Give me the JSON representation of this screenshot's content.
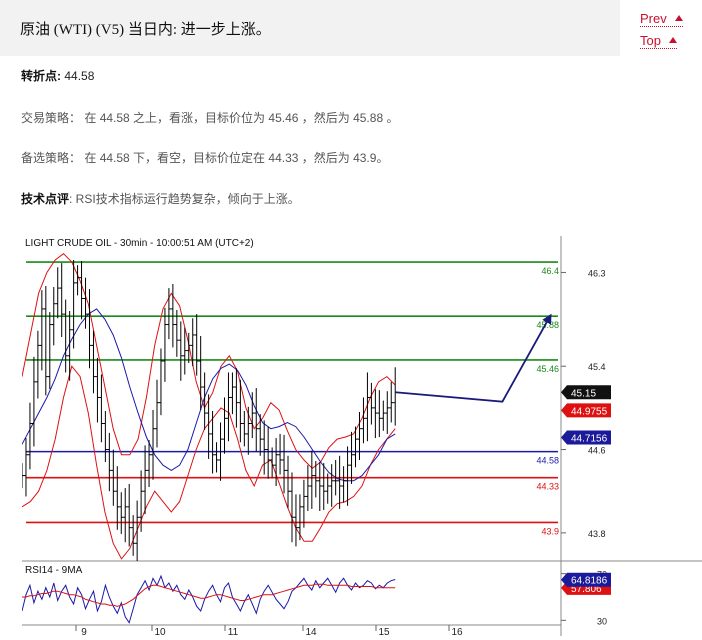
{
  "header": {
    "title": "原油 (WTI) (V5) 当日内: 进一步上涨。"
  },
  "nav": {
    "prev": "Prev",
    "top": "Top"
  },
  "pivot": {
    "label": "转折点:",
    "value": "44.58"
  },
  "strategy": {
    "label": "交易策略：",
    "text": "在 44.58 之上，看涨，目标价位为 45.46 ，然后为 45.88 。"
  },
  "alternative": {
    "label": "备选策略：",
    "text": "在 44.58 下，看空，目标价位定在 44.33 ，然后为 43.9。"
  },
  "comment": {
    "label": "技术点评",
    "text": ": RSI技术指标运行趋势复杂，倾向于上涨。"
  },
  "colors": {
    "resistance": "#1a8a1a",
    "pivot": "#1a1aaa",
    "support": "#dd1111",
    "bollinger": "#dd1111",
    "ma": "#1a1aaa",
    "arrow": "#1a1a7a"
  },
  "chart_data": [
    {
      "type": "candlestick",
      "title": "LIGHT CRUDE OIL - 30min - 10:00:51 AM (UTC+2)",
      "x_ticks": [
        "9",
        "10",
        "11",
        "14",
        "15",
        "16"
      ],
      "y_ticks": [
        46.3,
        45.4,
        44.6,
        43.8
      ],
      "ylim": [
        43.53,
        46.65
      ],
      "levels": [
        {
          "label": "46.4",
          "value": 46.4,
          "kind": "resistance"
        },
        {
          "label": "45.88",
          "value": 45.88,
          "kind": "resistance"
        },
        {
          "label": "45.46",
          "value": 45.46,
          "kind": "resistance"
        },
        {
          "label": "44.58",
          "value": 44.58,
          "kind": "pivot"
        },
        {
          "label": "44.33",
          "value": 44.33,
          "kind": "support"
        },
        {
          "label": "43.9",
          "value": 43.9,
          "kind": "support"
        }
      ],
      "last_price": {
        "label": "45.15",
        "value": 45.15
      },
      "upper_tag": {
        "label": "44.9755",
        "value": 44.9755
      },
      "ma_tag": {
        "label": "44.7156",
        "value": 44.7156
      },
      "indicators": [
        "Bollinger Bands",
        "Moving Average"
      ],
      "projection": [
        {
          "t": 121,
          "v": 45.06
        },
        {
          "t": 133,
          "v": 45.88
        }
      ],
      "close": [
        44.35,
        44.55,
        44.85,
        45.25,
        45.6,
        45.95,
        45.3,
        45.8,
        46.0,
        46.15,
        45.9,
        45.5,
        45.75,
        46.2,
        46.25,
        46.05,
        45.9,
        45.6,
        45.3,
        45.1,
        44.85,
        44.6,
        44.4,
        44.2,
        44.05,
        43.95,
        44.05,
        43.85,
        43.7,
        43.95,
        44.2,
        44.4,
        44.55,
        44.8,
        45.05,
        45.45,
        45.8,
        45.95,
        45.8,
        45.65,
        45.5,
        45.55,
        45.6,
        45.7,
        45.45,
        45.2,
        44.95,
        44.75,
        44.55,
        44.5,
        44.7,
        44.9,
        45.1,
        45.2,
        45.05,
        44.85,
        44.75,
        44.85,
        44.95,
        44.8,
        44.7,
        44.6,
        44.5,
        44.45,
        44.55,
        44.5,
        44.4,
        44.2,
        43.95,
        43.85,
        44.05,
        44.15,
        44.25,
        44.35,
        44.3,
        44.25,
        44.2,
        44.25,
        44.3,
        44.3,
        44.25,
        44.3,
        44.45,
        44.55,
        44.7,
        44.8,
        44.9,
        45.1,
        45.0,
        44.95,
        44.9,
        44.95,
        45.0,
        45.05,
        45.15
      ],
      "ma": [
        44.65,
        44.8,
        44.95,
        45.1,
        45.28,
        45.5,
        45.66,
        45.8,
        45.9,
        45.95,
        45.85,
        45.7,
        45.48,
        45.2,
        44.95,
        44.72,
        44.55,
        44.45,
        44.4,
        44.45,
        44.6,
        44.85,
        45.1,
        45.28,
        45.38,
        45.42,
        45.36,
        45.22,
        45.02,
        44.86,
        44.8,
        44.82,
        44.86,
        44.82,
        44.72,
        44.6,
        44.48,
        44.38,
        44.32,
        44.3,
        44.3,
        44.35,
        44.45,
        44.55,
        44.7,
        44.75
      ],
      "bb_upper": [
        45.3,
        45.7,
        46.1,
        46.3,
        46.42,
        46.48,
        46.4,
        46.22,
        46.0,
        45.6,
        45.2,
        44.8,
        44.55,
        44.55,
        44.7,
        45.1,
        45.6,
        45.95,
        46.1,
        45.98,
        45.65,
        45.25,
        45.0,
        45.15,
        45.4,
        45.5,
        45.35,
        45.0,
        44.8,
        44.9,
        45.05,
        44.98,
        44.78,
        44.6,
        44.5,
        44.42,
        44.48,
        44.62,
        44.7,
        44.72,
        44.75,
        44.9,
        45.1,
        45.25,
        45.3,
        45.22
      ],
      "bb_lower": [
        44.05,
        44.1,
        44.2,
        44.4,
        44.7,
        45.1,
        45.4,
        45.3,
        44.95,
        44.45,
        44.0,
        43.7,
        43.55,
        43.65,
        43.85,
        44.05,
        44.2,
        44.1,
        44.0,
        44.1,
        44.35,
        44.6,
        44.8,
        44.9,
        45.0,
        44.95,
        44.7,
        44.4,
        44.25,
        44.45,
        44.5,
        44.28,
        44.05,
        43.85,
        43.72,
        43.72,
        43.85,
        44.0,
        44.08,
        44.1,
        44.15,
        44.25,
        44.45,
        44.6,
        44.7,
        44.8
      ]
    },
    {
      "type": "line",
      "title": "RSI14 - 9MA",
      "series_names": [
        "RSI14",
        "9MA"
      ],
      "y_ticks": [
        70,
        30
      ],
      "ylim": [
        20,
        80
      ],
      "last_values": [
        {
          "label": "64.8186",
          "value": 64.8186
        },
        {
          "label": "57.806",
          "value": 57.806
        }
      ],
      "rsi": [
        38,
        52,
        60,
        45,
        55,
        48,
        58,
        50,
        62,
        47,
        55,
        60,
        50,
        44,
        58,
        52,
        40,
        48,
        55,
        38,
        46,
        60,
        50,
        42,
        36,
        45,
        33,
        28,
        40,
        52,
        58,
        64,
        56,
        66,
        60,
        68,
        58,
        62,
        55,
        60,
        52,
        48,
        56,
        50,
        42,
        38,
        48,
        55,
        60,
        52,
        46,
        58,
        62,
        50,
        44,
        38,
        46,
        52,
        44,
        36,
        48,
        55,
        60,
        54,
        48,
        44,
        40,
        46,
        55,
        58,
        62,
        66,
        60,
        56,
        64,
        58,
        62,
        66,
        60,
        54,
        62,
        66,
        60,
        56,
        62,
        58,
        60,
        64,
        62,
        57,
        60,
        58,
        62,
        64,
        65
      ],
      "rsi_ma": [
        50,
        50,
        51,
        51,
        52,
        53,
        53,
        54,
        55,
        55,
        54,
        53,
        52,
        52,
        51,
        50,
        48,
        47,
        46,
        45,
        44,
        44,
        43,
        43,
        42,
        43,
        44,
        46,
        48,
        51,
        54,
        57,
        59,
        60,
        60,
        59,
        58,
        57,
        56,
        55,
        54,
        53,
        52,
        51,
        50,
        49,
        49,
        50,
        51,
        52,
        52,
        51,
        50,
        49,
        48,
        47,
        47,
        48,
        49,
        50,
        51,
        52,
        52,
        52,
        53,
        54,
        55,
        56,
        57,
        58,
        59,
        60,
        60,
        60,
        61,
        61,
        61,
        60,
        60,
        60,
        60,
        60,
        60,
        59,
        59,
        59,
        59,
        59,
        59,
        58,
        58,
        58,
        58,
        58,
        58
      ]
    }
  ]
}
